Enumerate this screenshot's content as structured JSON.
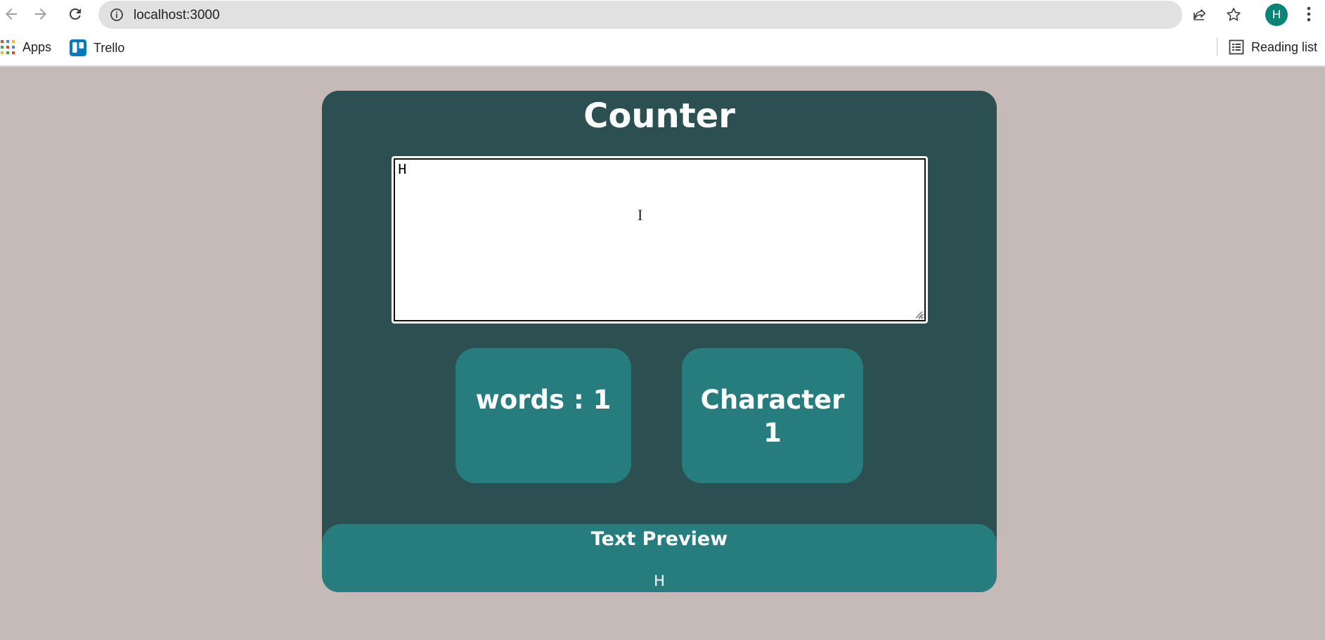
{
  "browser": {
    "url": "localhost:3000",
    "avatar_letter": "H",
    "bookmarks": [
      {
        "label": "Apps",
        "icon": "apps-grid-icon"
      },
      {
        "label": "Trello",
        "icon": "trello-icon"
      }
    ],
    "reading_list": "Reading list",
    "colors": {
      "avatar": "#0b8478",
      "trello": "#0079bf"
    }
  },
  "app": {
    "title": "Counter",
    "textarea_value": "H",
    "words_label": "words : 1",
    "characters_label": "Character",
    "characters_value": "1",
    "preview_title": "Text Preview",
    "preview_text": "H",
    "colors": {
      "background": "#c6bab9",
      "card": "#2c5051",
      "tile": "#277d7e",
      "text": "#ffffff"
    }
  }
}
